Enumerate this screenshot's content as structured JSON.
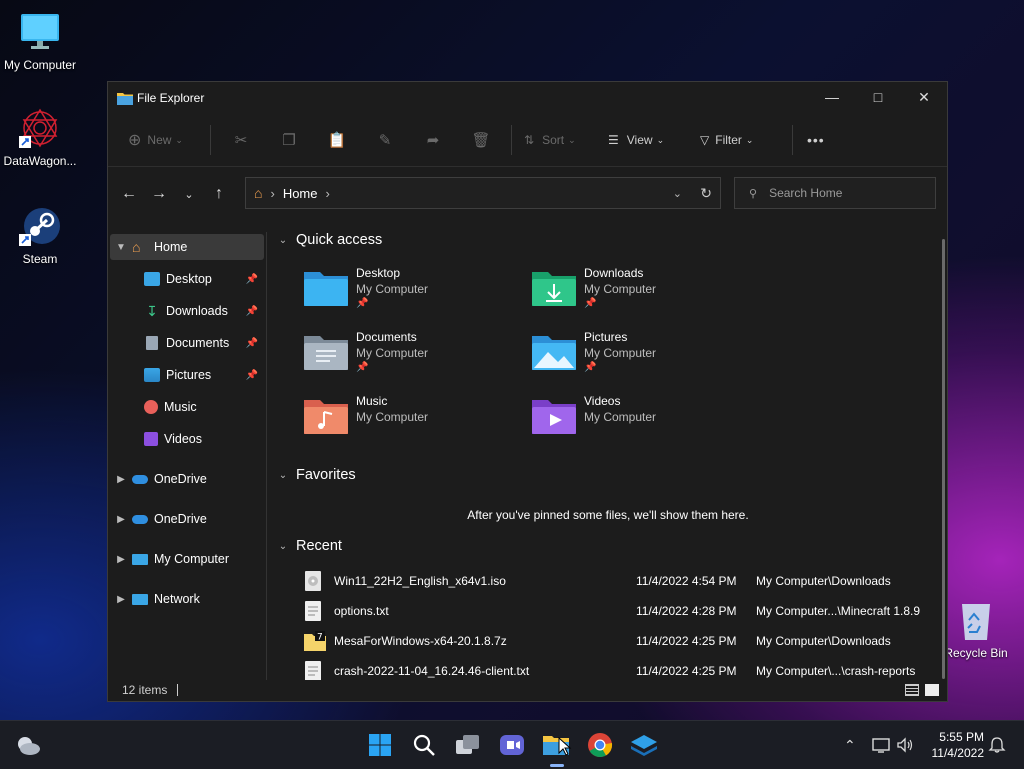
{
  "desktop": {
    "icons": [
      {
        "label": "My Computer"
      },
      {
        "label": "DataWagon..."
      },
      {
        "label": "Steam"
      },
      {
        "label": "Recycle Bin"
      }
    ]
  },
  "window": {
    "title": "File Explorer",
    "toolbar": {
      "new_label": "New",
      "sort_label": "Sort",
      "view_label": "View",
      "filter_label": "Filter",
      "more_label": "•••"
    },
    "address": {
      "crumb": "Home",
      "search_placeholder": "Search Home"
    },
    "nav": {
      "home": "Home",
      "items": [
        {
          "label": "Desktop",
          "pinned": true
        },
        {
          "label": "Downloads",
          "pinned": true
        },
        {
          "label": "Documents",
          "pinned": true
        },
        {
          "label": "Pictures",
          "pinned": true
        },
        {
          "label": "Music",
          "pinned": false
        },
        {
          "label": "Videos",
          "pinned": false
        }
      ],
      "groups": [
        {
          "label": "OneDrive"
        },
        {
          "label": "OneDrive"
        },
        {
          "label": "My Computer"
        },
        {
          "label": "Network"
        }
      ]
    },
    "quick_access": {
      "heading": "Quick access",
      "items": [
        {
          "name": "Desktop",
          "location": "My Computer",
          "pinned": true
        },
        {
          "name": "Downloads",
          "location": "My Computer",
          "pinned": true
        },
        {
          "name": "Documents",
          "location": "My Computer",
          "pinned": true
        },
        {
          "name": "Pictures",
          "location": "My Computer",
          "pinned": true
        },
        {
          "name": "Music",
          "location": "My Computer",
          "pinned": false
        },
        {
          "name": "Videos",
          "location": "My Computer",
          "pinned": false
        }
      ]
    },
    "favorites": {
      "heading": "Favorites",
      "empty_message": "After you've pinned some files, we'll show them here."
    },
    "recent": {
      "heading": "Recent",
      "files": [
        {
          "name": "Win11_22H2_English_x64v1.iso",
          "date": "11/4/2022 4:54 PM",
          "location": "My Computer\\Downloads"
        },
        {
          "name": "options.txt",
          "date": "11/4/2022 4:28 PM",
          "location": "My Computer...\\Minecraft 1.8.9"
        },
        {
          "name": "MesaForWindows-x64-20.1.8.7z",
          "date": "11/4/2022 4:25 PM",
          "location": "My Computer\\Downloads"
        },
        {
          "name": "crash-2022-11-04_16.24.46-client.txt",
          "date": "11/4/2022 4:25 PM",
          "location": "My Computer\\...\\crash-reports"
        }
      ]
    },
    "status": {
      "count": "12 items"
    }
  },
  "taskbar": {
    "clock_time": "5:55 PM",
    "clock_date": "11/4/2022"
  }
}
